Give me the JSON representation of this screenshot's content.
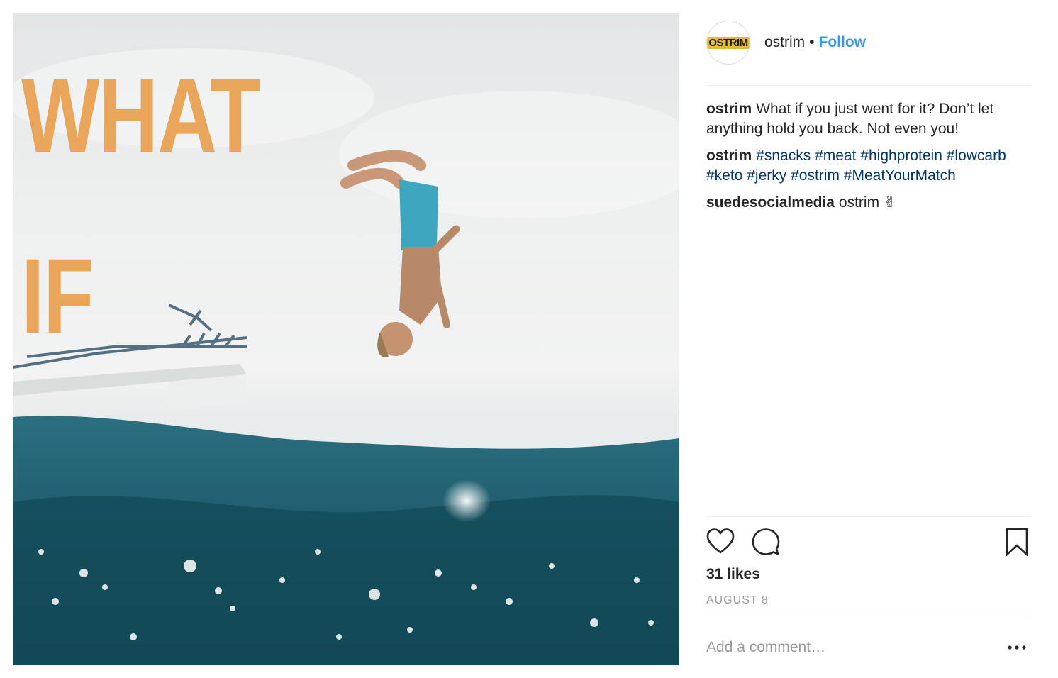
{
  "post": {
    "image": {
      "headline_line1": "WHAT",
      "headline_line2": "IF",
      "headline_color": "#e9a55a",
      "water_color": "#1f5e6e"
    },
    "header": {
      "avatar_logo_text": "OSTRIM",
      "username": "ostrim",
      "separator": "•",
      "follow_label": "Follow"
    },
    "comments": [
      {
        "user": "ostrim",
        "text": "What if you just went for it? Don’t let anything hold you back. Not even you!"
      },
      {
        "user": "ostrim",
        "hashtags": [
          "#snacks",
          "#meat",
          "#highprotein",
          "#lowcarb",
          "#keto",
          "#jerky",
          "#ostrim",
          "#MeatYourMatch"
        ]
      },
      {
        "user": "suedesocialmedia",
        "text": "ostrim ✌"
      }
    ],
    "actions": {
      "like_icon": "heart-icon",
      "comment_icon": "comment-icon",
      "save_icon": "bookmark-icon"
    },
    "likes": "31 likes",
    "date": "AUGUST 8",
    "add_comment_placeholder": "Add a comment…",
    "more_icon": "more-options-icon",
    "colors": {
      "link": "#3897f0",
      "hashtag": "#003569",
      "muted": "#999999"
    }
  }
}
